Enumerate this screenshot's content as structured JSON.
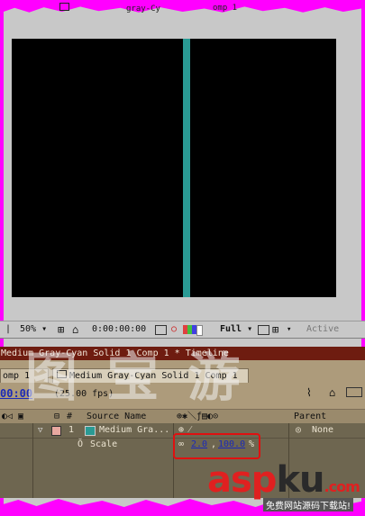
{
  "window": {
    "title_fragment_1": "gray-Cy",
    "title_fragment_2": "omp 1"
  },
  "viewer_bar": {
    "zoom": "50%",
    "timecode": "0:00:00:00",
    "resolution": "Full",
    "camera": "Active"
  },
  "timeline": {
    "window_title": "Medium Gray-Cyan Solid 1 Comp 1 * Timeline",
    "tabs": [
      {
        "label": "omp 1"
      },
      {
        "label": "Medium Gray-Cyan Solid 1 Comp 1"
      }
    ],
    "current_time": "00:00",
    "fps": "(25.00 fps)",
    "columns": {
      "num": "#",
      "source_name": "Source Name",
      "parent": "Parent"
    },
    "layer": {
      "number": "1",
      "name": "Medium Gra...",
      "parent": "None",
      "label_color": "#e8a8a0"
    },
    "property": {
      "name": "Scale",
      "value_x": "2.0",
      "separator": ",",
      "value_y": "100.0",
      "unit": "%"
    }
  },
  "watermark": {
    "text": "图 宝 游",
    "brand_red": "asp",
    "brand_dark": "ku",
    "brand_suffix": ".com",
    "tagline": "免费网站源码下载站!"
  },
  "colors": {
    "solid": "#2a9a94",
    "timeline_title_bg": "#6e1c10",
    "highlight": "#e01010"
  }
}
